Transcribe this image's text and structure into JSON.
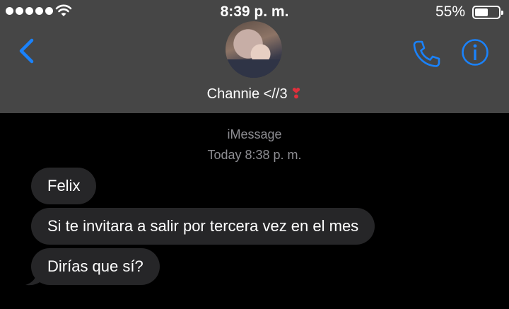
{
  "status_bar": {
    "time": "8:39 p. m.",
    "battery_percent": "55%",
    "battery_level": 0.55,
    "signal_bars": 5
  },
  "nav": {
    "back_icon": "chevron-left-icon",
    "call_icon": "phone-icon",
    "info_icon": "info-icon",
    "accent_color": "#1a82fb"
  },
  "contact": {
    "name": "Channie <//3",
    "emoji": "❣"
  },
  "thread": {
    "service": "iMessage",
    "timestamp": "Today 8:38 p. m.",
    "messages": [
      {
        "text": "Felix"
      },
      {
        "text": "Si te invitara a salir por tercera vez en el mes"
      },
      {
        "text": "Dirías que sí?"
      }
    ]
  }
}
